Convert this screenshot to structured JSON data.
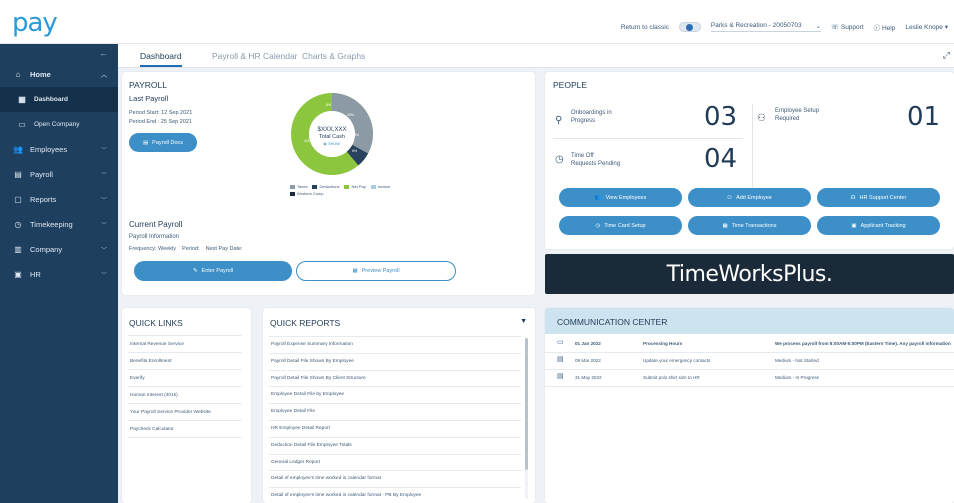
{
  "app": {
    "logo": "pay"
  },
  "topbar": {
    "return_label": "Return to classic",
    "company": "Parks & Recreation - 20050703",
    "support": "Support",
    "help": "Help",
    "user": "Leslie Knope"
  },
  "sidebar": {
    "items": [
      {
        "label": "Home",
        "icon": "home-icon"
      },
      {
        "label": "Dashboard",
        "icon": "dashboard-icon"
      },
      {
        "label": "Open Company",
        "icon": "folder-icon"
      },
      {
        "label": "Employees",
        "icon": "employees-icon"
      },
      {
        "label": "Payroll",
        "icon": "payroll-icon"
      },
      {
        "label": "Reports",
        "icon": "reports-icon"
      },
      {
        "label": "Timekeeping",
        "icon": "clock-icon"
      },
      {
        "label": "Company",
        "icon": "building-icon"
      },
      {
        "label": "HR",
        "icon": "id-card-icon"
      }
    ]
  },
  "tabs": [
    {
      "label": "Dashboard"
    },
    {
      "label": "Payroll & HR Calendar"
    },
    {
      "label": "Charts & Graphs"
    }
  ],
  "payroll": {
    "title": "PAYROLL",
    "last_payroll": "Last Payroll",
    "period_start": "Period Start: 12 Sep 2021",
    "period_end": "Period End : 25 Sep 2021",
    "docs_button": "Payroll Docs",
    "donut_value": "$XXX,XXX",
    "donut_label": "Total Cash",
    "donut_show": "SHOW",
    "donut_slices": [
      {
        "name": "Taxes",
        "color": "#8c9aa6",
        "value": 33
      },
      {
        "name": "Deductions",
        "color": "#27415f",
        "value": 6
      },
      {
        "name": "Net Pay",
        "color": "#8cc63f",
        "value": 61
      }
    ],
    "slice_labels": [
      "33%",
      "6%",
      "13%",
      "8%",
      "41%"
    ],
    "legend": [
      "Taxes",
      "Deductions",
      "Net Pay",
      "Invoice",
      "Workers Comp"
    ],
    "current_payroll": "Current Payroll",
    "payroll_info": "Payroll Information",
    "frequency_line": "Frequency: Weekly    Period:    Next Pay Date:",
    "enter_button": "Enter Payroll",
    "preview_button": "Preview Payroll"
  },
  "people": {
    "title": "PEOPLE",
    "stats": [
      {
        "label1": "Onboardings in",
        "label2": "Progress",
        "value": "03"
      },
      {
        "label1": "Employee Setup",
        "label2": "Required",
        "value": "01"
      },
      {
        "label1": "Time Off",
        "label2": "Requests Pending",
        "value": "04"
      }
    ],
    "buttons": [
      "View Employees",
      "Add Employee",
      "HR Support Center",
      "Time Card Setup",
      "Time Transactions",
      "Applicant Tracking"
    ]
  },
  "banner": {
    "text": "TimeWorksPlus."
  },
  "quick_links": {
    "title": "QUICK LINKS",
    "items": [
      "Internal Revenue Service",
      "Benefits Enrollment",
      "Everify",
      "Human Interest (401k)",
      "Your Payroll Service Provider Website",
      "Paycheck Calculator"
    ]
  },
  "quick_reports": {
    "title": "QUICK REPORTS",
    "items": [
      "Payroll Expense Summary Information",
      "Payroll Detail File Shown By Employee",
      "Payroll Detail File Shown By Client Structure",
      "Employee Detail File by Employee",
      "Employee Detail File",
      "HR Employee Detail Report",
      "Deduction Detail File Employee Totals",
      "General Ledger Report",
      "Detail of employee's time worked in calendar format",
      "Detail of employee's time worked in calendar format - PB By Employee"
    ]
  },
  "communication": {
    "title": "COMMUNICATION CENTER",
    "rows": [
      {
        "date": "01 Jan 2022",
        "subject": "Processing Hours",
        "status": "We process payroll from 8:00AM-5:00PM (Eastern Time). Any payroll information r"
      },
      {
        "date": "09 Mar 2022",
        "subject": "Update your emergency contacts",
        "status": "Medium - Not Started"
      },
      {
        "date": "31 May 2022",
        "subject": "Submit polo shirt size to HR",
        "status": "Medium - In Progress"
      }
    ]
  }
}
